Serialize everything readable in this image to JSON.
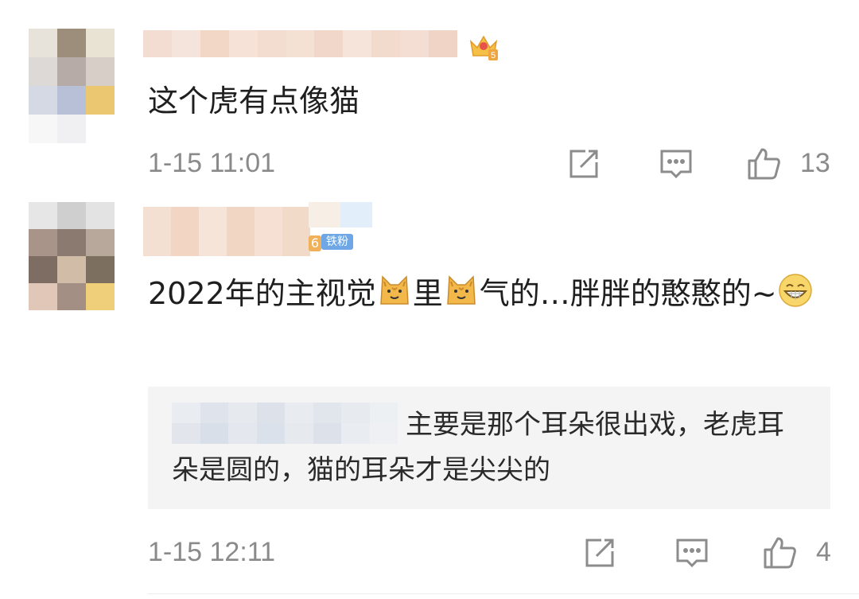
{
  "comments": [
    {
      "text": "这个虎有点像猫",
      "time": "1-15 11:01",
      "likes": "13",
      "badge": "crown-level-5-icon"
    },
    {
      "text_parts": [
        "2022年的主视觉",
        "里",
        "气的…胖胖的憨憨的~"
      ],
      "time": "1-15 12:11",
      "likes": "4",
      "badge_level": "6",
      "badge_text": "铁粉",
      "reply": {
        "text": "主要是那个耳朵很出戏，老虎耳朵是圆的，猫的耳朵才是尖尖的"
      }
    }
  ],
  "colors": {
    "text": "#1f1f1f",
    "meta": "#8a8a8a",
    "reply_bg": "#f4f4f4",
    "icon": "#8c8c8c"
  }
}
